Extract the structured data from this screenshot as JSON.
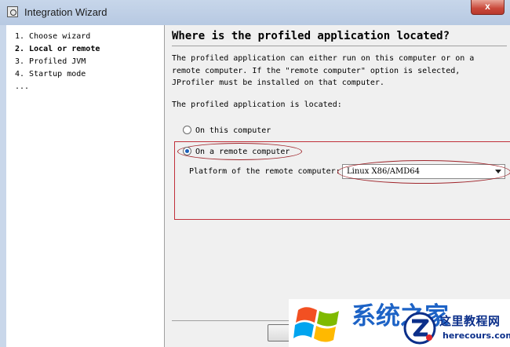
{
  "window": {
    "title": "Integration Wizard",
    "close_label": "x"
  },
  "steps": [
    {
      "label": "1. Choose wizard",
      "current": false
    },
    {
      "label": "2. Local or remote",
      "current": true
    },
    {
      "label": "3. Profiled JVM",
      "current": false
    },
    {
      "label": "4. Startup mode",
      "current": false
    },
    {
      "label": "...",
      "current": false
    }
  ],
  "content": {
    "heading": "Where is the profiled application located?",
    "description_lines": [
      "The profiled application can either run on this computer or on a",
      "remote computer. If the \"remote computer\" option is selected,",
      "JProfiler must be installed on that computer."
    ],
    "location_prompt": "The profiled application is located:",
    "options": [
      {
        "label": "On this computer",
        "checked": false
      },
      {
        "label": "On a remote computer",
        "checked": true
      }
    ],
    "platform": {
      "label": "Platform of the remote computer:",
      "selected": "Linux X86/AMD64"
    }
  },
  "buttons": {
    "back": "<",
    "next": ""
  },
  "watermark": {
    "brand": "系统之家",
    "name": "这里教程网",
    "url": "herecours.com"
  },
  "colors": {
    "annotation_red": "#c0303a",
    "radio_blue": "#1b5fb8",
    "watermark_blue": "#0b2f8a",
    "client_bg": "#f0f0f0"
  }
}
